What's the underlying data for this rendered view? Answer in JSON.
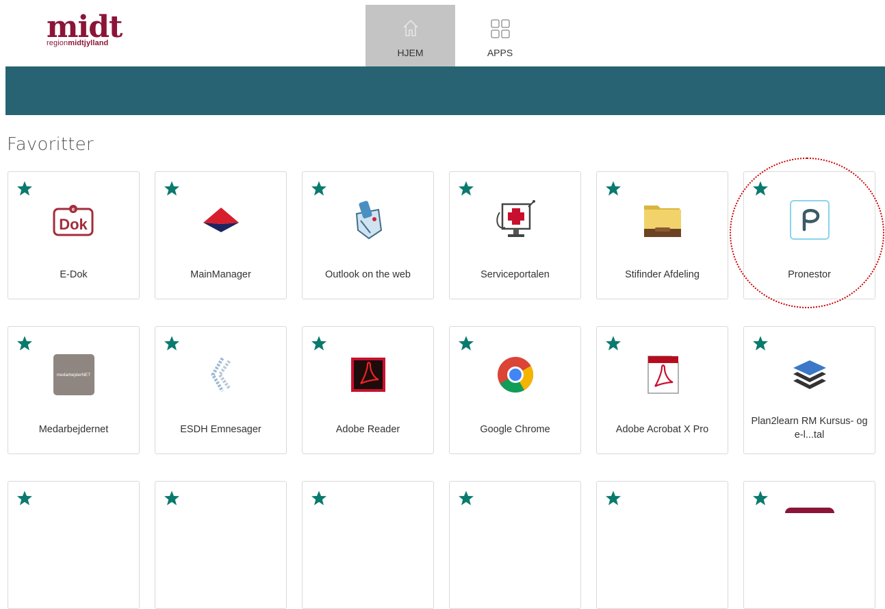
{
  "logo": {
    "main": "midt",
    "sub_prefix": "region",
    "sub_bold": "midtjylland"
  },
  "nav": {
    "home_label": "HJEM",
    "apps_label": "APPS"
  },
  "section": {
    "title": "Favoritter"
  },
  "colors": {
    "brand": "#8a1538",
    "banner": "#276372",
    "star": "#0b7a6e",
    "nav_active": "#c4c4c4",
    "highlight_circle": "#cc0000"
  },
  "tiles": [
    {
      "label": "E-Dok",
      "icon": "edok-icon"
    },
    {
      "label": "MainManager",
      "icon": "mainmanager-icon"
    },
    {
      "label": "Outlook on the web",
      "icon": "outlook-icon"
    },
    {
      "label": "Serviceportalen",
      "icon": "serviceportal-icon"
    },
    {
      "label": "Stifinder Afdeling",
      "icon": "folder-icon"
    },
    {
      "label": "Pronestor",
      "icon": "pronestor-icon"
    },
    {
      "label": "Medarbejdernet",
      "icon": "medarbejdernet-icon",
      "icon_text": "medarbejderNET"
    },
    {
      "label": "ESDH Emnesager",
      "icon": "esdh-icon"
    },
    {
      "label": "Adobe Reader",
      "icon": "adobe-reader-icon"
    },
    {
      "label": "Google Chrome",
      "icon": "chrome-icon"
    },
    {
      "label": "Adobe Acrobat X Pro",
      "icon": "acrobat-icon"
    },
    {
      "label": "Plan2learn RM Kursus- og e-l...tal",
      "icon": "layers-icon"
    }
  ]
}
